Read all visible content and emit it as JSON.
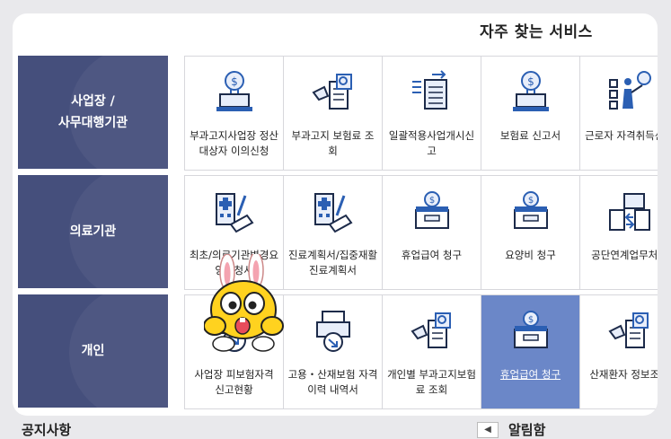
{
  "section_title": "자주 찾는 서비스",
  "rows": [
    {
      "title": "사업장 /\n사무대행기관",
      "items": [
        {
          "label": "부과고지사업장 정산대상자 이의신청",
          "icon": "laptop-coin-icon"
        },
        {
          "label": "부과고지 보험료 조회",
          "icon": "search-receipt-icon"
        },
        {
          "label": "일괄적용사업개시신고",
          "icon": "document-list-icon"
        },
        {
          "label": "보험료 신고서",
          "icon": "laptop-coin-icon"
        },
        {
          "label": "근로자 자격취득신고",
          "icon": "presentation-icon"
        }
      ]
    },
    {
      "title": "의료기관",
      "items": [
        {
          "label": "최초/의료기관변경요양신청서",
          "icon": "hospital-pen-icon"
        },
        {
          "label": "진료계획서/집중재활진료계획서",
          "icon": "hospital-pen-icon"
        },
        {
          "label": "휴업급여 청구",
          "icon": "coin-box-icon"
        },
        {
          "label": "요양비 청구",
          "icon": "coin-box-icon"
        },
        {
          "label": "공단연계업무처리",
          "icon": "folder-exchange-icon"
        }
      ]
    },
    {
      "title": "개인",
      "items": [
        {
          "label": "사업장 피보험자격 신고현황",
          "icon": "download-circle-icon"
        },
        {
          "label": "고용・산재보험 자격 이력 내역서",
          "icon": "printer-icon"
        },
        {
          "label": "개인별 부과고지보험료 조회",
          "icon": "search-receipt-icon"
        },
        {
          "label": "휴업급여 청구",
          "icon": "coin-box-icon",
          "active": true
        },
        {
          "label": "산재환자 정보조회",
          "icon": "search-receipt-icon"
        }
      ]
    }
  ],
  "bottom_left": "공지사항",
  "bottom_right": "알림함",
  "colors": {
    "row_head": "#454f7c",
    "active_cell": "#6b87c8",
    "icon_blue": "#2b5fb3"
  }
}
